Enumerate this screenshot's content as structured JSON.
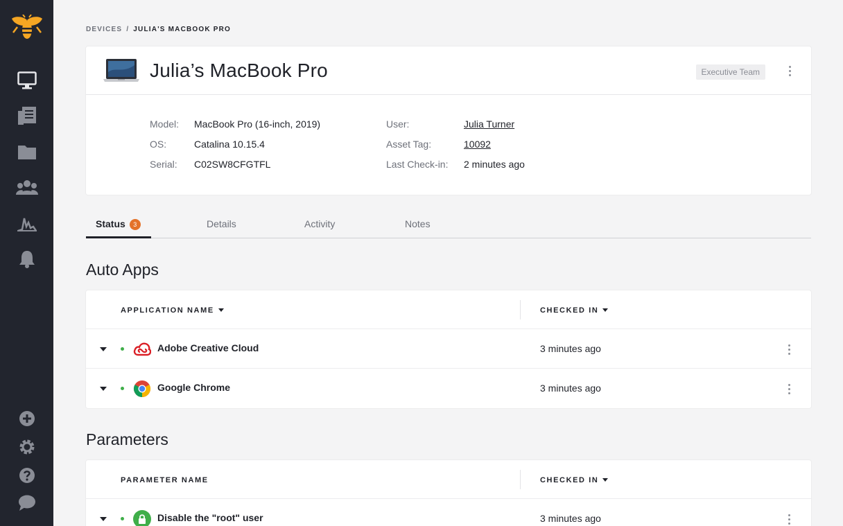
{
  "breadcrumb": {
    "root": "Devices",
    "separator": "/",
    "current": "Julia's MacBook Pro"
  },
  "device": {
    "title": "Julia’s MacBook Pro",
    "tag": "Executive Team",
    "info": {
      "model_label": "Model:",
      "model": "MacBook Pro (16-inch, 2019)",
      "os_label": "OS:",
      "os": "Catalina 10.15.4",
      "serial_label": "Serial:",
      "serial": "C02SW8CFGTFL",
      "user_label": "User:",
      "user": "Julia Turner",
      "asset_label": "Asset Tag:",
      "asset": "10092",
      "checkin_label": "Last Check-in:",
      "checkin": "2 minutes ago"
    }
  },
  "tabs": [
    {
      "label": "Status",
      "badge": "3",
      "active": true
    },
    {
      "label": "Details"
    },
    {
      "label": "Activity"
    },
    {
      "label": "Notes"
    }
  ],
  "auto_apps": {
    "title": "Auto Apps",
    "col_name": "Application Name",
    "col_checked": "Checked In",
    "rows": [
      {
        "name": "Adobe Creative Cloud",
        "icon": "adobe-creative-cloud-icon",
        "checked": "3 minutes ago"
      },
      {
        "name": "Google Chrome",
        "icon": "google-chrome-icon",
        "checked": "3 minutes ago"
      }
    ]
  },
  "parameters": {
    "title": "Parameters",
    "col_name": "Parameter Name",
    "col_checked": "Checked In",
    "rows": [
      {
        "name": "Disable the \"root\" user",
        "icon": "lock-icon",
        "checked": "3 minutes ago"
      }
    ]
  },
  "colors": {
    "sidebar": "#22252e",
    "badge": "#e47229",
    "status_dot": "#3fae49",
    "accent_logo": "#f5a623"
  }
}
